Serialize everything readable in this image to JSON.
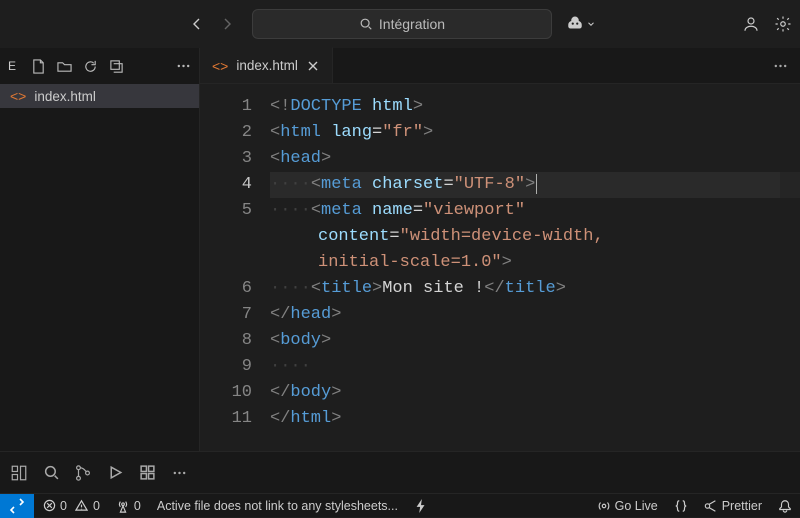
{
  "header": {
    "search_placeholder": "Intégration"
  },
  "sidebar": {
    "section_letter": "E",
    "files": [
      {
        "name": "index.html"
      }
    ]
  },
  "tabs": [
    {
      "name": "index.html"
    }
  ],
  "editor": {
    "filename": "index.html",
    "language": "html",
    "current_line": 4,
    "lines": [
      {
        "no": 1,
        "segments": [
          {
            "c": "pun",
            "t": "<!"
          },
          {
            "c": "kw",
            "t": "DOCTYPE"
          },
          {
            "c": "txt",
            "t": " "
          },
          {
            "c": "attr",
            "t": "html"
          },
          {
            "c": "pun",
            "t": ">"
          }
        ]
      },
      {
        "no": 2,
        "segments": [
          {
            "c": "pun",
            "t": "<"
          },
          {
            "c": "kw",
            "t": "html"
          },
          {
            "c": "txt",
            "t": " "
          },
          {
            "c": "attr",
            "t": "lang"
          },
          {
            "c": "txt",
            "t": "="
          },
          {
            "c": "str",
            "t": "\"fr\""
          },
          {
            "c": "pun",
            "t": ">"
          }
        ]
      },
      {
        "no": 3,
        "segments": [
          {
            "c": "pun",
            "t": "<"
          },
          {
            "c": "kw",
            "t": "head"
          },
          {
            "c": "pun",
            "t": ">"
          }
        ]
      },
      {
        "no": 4,
        "dots": "····",
        "segments": [
          {
            "c": "pun",
            "t": "<"
          },
          {
            "c": "kw",
            "t": "meta"
          },
          {
            "c": "txt",
            "t": " "
          },
          {
            "c": "attr",
            "t": "charset"
          },
          {
            "c": "txt",
            "t": "="
          },
          {
            "c": "str",
            "t": "\"UTF-8\""
          },
          {
            "c": "pun",
            "t": ">"
          }
        ]
      },
      {
        "no": 5,
        "dots": "····",
        "segments": [
          {
            "c": "pun",
            "t": "<"
          },
          {
            "c": "kw",
            "t": "meta"
          },
          {
            "c": "txt",
            "t": " "
          },
          {
            "c": "attr",
            "t": "name"
          },
          {
            "c": "txt",
            "t": "="
          },
          {
            "c": "str",
            "t": "\"viewport\""
          }
        ],
        "wraps": [
          [
            {
              "c": "attr",
              "t": "content"
            },
            {
              "c": "txt",
              "t": "="
            },
            {
              "c": "str",
              "t": "\"width=device-width, "
            }
          ],
          [
            {
              "c": "str",
              "t": "initial-scale=1.0\""
            },
            {
              "c": "pun",
              "t": ">"
            }
          ]
        ]
      },
      {
        "no": 6,
        "dots": "····",
        "segments": [
          {
            "c": "pun",
            "t": "<"
          },
          {
            "c": "kw",
            "t": "title"
          },
          {
            "c": "pun",
            "t": ">"
          },
          {
            "c": "txt",
            "t": "Mon site !"
          },
          {
            "c": "pun",
            "t": "</"
          },
          {
            "c": "kw",
            "t": "title"
          },
          {
            "c": "pun",
            "t": ">"
          }
        ]
      },
      {
        "no": 7,
        "segments": [
          {
            "c": "pun",
            "t": "</"
          },
          {
            "c": "kw",
            "t": "head"
          },
          {
            "c": "pun",
            "t": ">"
          }
        ]
      },
      {
        "no": 8,
        "segments": [
          {
            "c": "pun",
            "t": "<"
          },
          {
            "c": "kw",
            "t": "body"
          },
          {
            "c": "pun",
            "t": ">"
          }
        ]
      },
      {
        "no": 9,
        "dots": "····",
        "segments": []
      },
      {
        "no": 10,
        "segments": [
          {
            "c": "pun",
            "t": "</"
          },
          {
            "c": "kw",
            "t": "body"
          },
          {
            "c": "pun",
            "t": ">"
          }
        ]
      },
      {
        "no": 11,
        "segments": [
          {
            "c": "pun",
            "t": "</"
          },
          {
            "c": "kw",
            "t": "html"
          },
          {
            "c": "pun",
            "t": ">"
          }
        ]
      }
    ]
  },
  "status": {
    "errors": "0",
    "warnings": "0",
    "ports": "0",
    "message": "Active file does not link to any stylesheets...",
    "golive": "Go Live",
    "prettier": "Prettier"
  }
}
